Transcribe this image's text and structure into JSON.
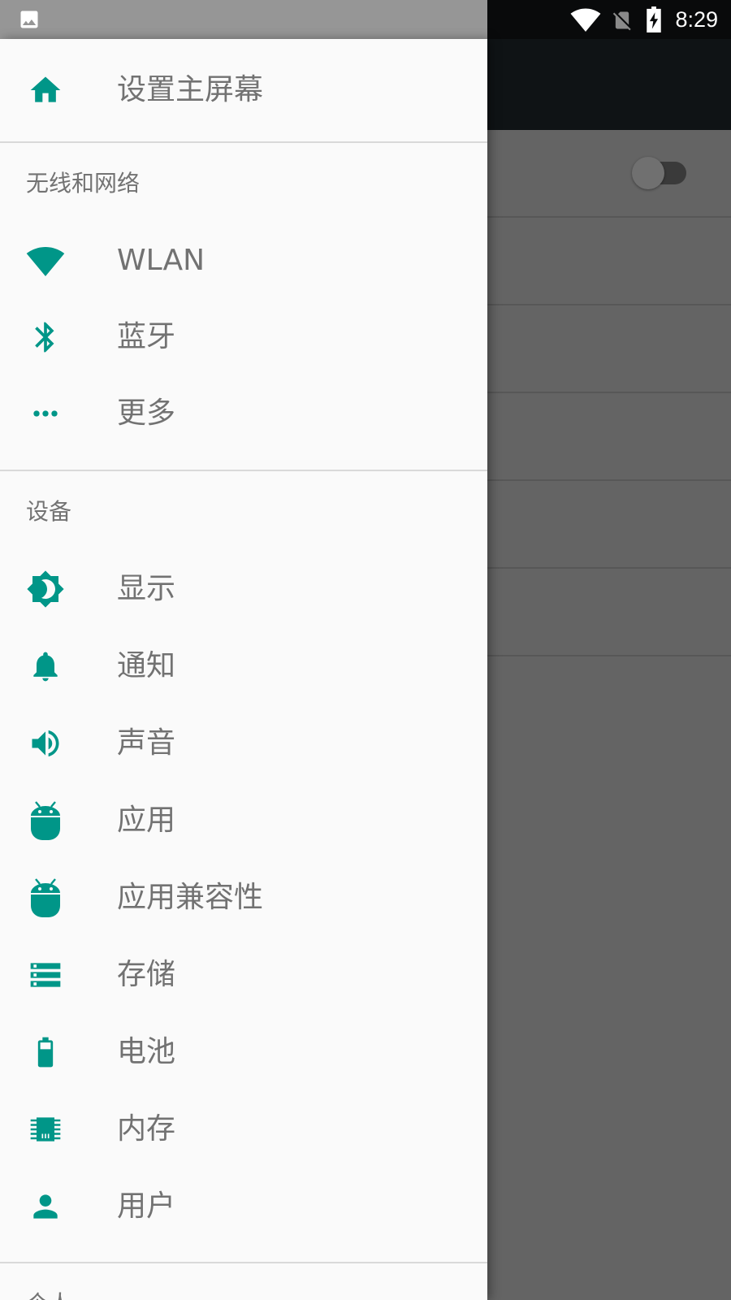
{
  "status_bar": {
    "time": "8:29",
    "left_icon": "image-icon",
    "right_icons": [
      "wifi-icon",
      "no-sim-icon",
      "battery-charging-icon"
    ]
  },
  "drawer": {
    "home": {
      "label": "设置主屏幕",
      "icon": "home-icon"
    },
    "sections": [
      {
        "header": "无线和网络",
        "items": [
          {
            "label": "WLAN",
            "icon": "wifi-icon"
          },
          {
            "label": "蓝牙",
            "icon": "bluetooth-icon"
          },
          {
            "label": "更多",
            "icon": "more-horiz-icon"
          }
        ]
      },
      {
        "header": "设备",
        "items": [
          {
            "label": "显示",
            "icon": "brightness-icon"
          },
          {
            "label": "通知",
            "icon": "bell-icon"
          },
          {
            "label": "声音",
            "icon": "volume-icon"
          },
          {
            "label": "应用",
            "icon": "android-icon"
          },
          {
            "label": "应用兼容性",
            "icon": "android-icon"
          },
          {
            "label": "存储",
            "icon": "storage-icon"
          },
          {
            "label": "电池",
            "icon": "battery-icon"
          },
          {
            "label": "内存",
            "icon": "memory-icon"
          },
          {
            "label": "用户",
            "icon": "person-icon"
          }
        ]
      },
      {
        "header": "个人",
        "items": []
      }
    ]
  },
  "colors": {
    "accent": "#009688",
    "drawer_bg": "#fafafa",
    "label_text": "#727272",
    "status_bar_left": "#969696"
  }
}
